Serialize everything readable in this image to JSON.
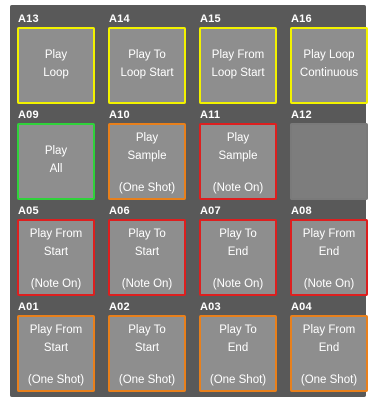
{
  "pads": [
    {
      "id": "A13",
      "color": "#f2f200",
      "style": "yellow",
      "lines": [
        "Play",
        "Loop"
      ],
      "note": ""
    },
    {
      "id": "A14",
      "color": "#f2f200",
      "style": "yellow",
      "lines": [
        "Play To",
        "Loop Start"
      ],
      "note": ""
    },
    {
      "id": "A15",
      "color": "#f2f200",
      "style": "yellow",
      "lines": [
        "Play From",
        "Loop Start"
      ],
      "note": ""
    },
    {
      "id": "A16",
      "color": "#f2f200",
      "style": "yellow",
      "lines": [
        "Play Loop",
        "Continuous"
      ],
      "note": ""
    },
    {
      "id": "A09",
      "color": "#2fd23a",
      "style": "green",
      "lines": [
        "Play",
        "All"
      ],
      "note": ""
    },
    {
      "id": "A10",
      "color": "#e8801c",
      "style": "orange",
      "lines": [
        "Play",
        "Sample"
      ],
      "note": "(One Shot)"
    },
    {
      "id": "A11",
      "color": "#dd1f1f",
      "style": "red",
      "lines": [
        "Play",
        "Sample"
      ],
      "note": "(Note On)"
    },
    {
      "id": "A12",
      "color": "#7a7a7a",
      "style": "empty",
      "lines": [
        "",
        ""
      ],
      "note": ""
    },
    {
      "id": "A05",
      "color": "#dd1f1f",
      "style": "red",
      "lines": [
        "Play From",
        "Start"
      ],
      "note": "(Note On)"
    },
    {
      "id": "A06",
      "color": "#dd1f1f",
      "style": "red",
      "lines": [
        "Play To",
        "Start"
      ],
      "note": "(Note On)"
    },
    {
      "id": "A07",
      "color": "#dd1f1f",
      "style": "red",
      "lines": [
        "Play To",
        "End"
      ],
      "note": "(Note On)"
    },
    {
      "id": "A08",
      "color": "#dd1f1f",
      "style": "red",
      "lines": [
        "Play From",
        "End"
      ],
      "note": "(Note On)"
    },
    {
      "id": "A01",
      "color": "#e8801c",
      "style": "orange",
      "lines": [
        "Play From",
        "Start"
      ],
      "note": "(One Shot)"
    },
    {
      "id": "A02",
      "color": "#e8801c",
      "style": "orange",
      "lines": [
        "Play To",
        "Start"
      ],
      "note": "(One Shot)"
    },
    {
      "id": "A03",
      "color": "#e8801c",
      "style": "orange",
      "lines": [
        "Play To",
        "End"
      ],
      "note": "(One Shot)"
    },
    {
      "id": "A04",
      "color": "#e8801c",
      "style": "orange",
      "lines": [
        "Play From",
        "End"
      ],
      "note": "(One Shot)"
    }
  ]
}
